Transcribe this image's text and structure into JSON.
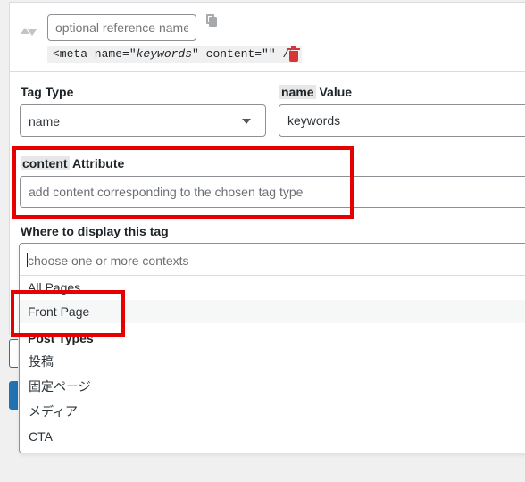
{
  "meta_entry": {
    "reference_placeholder": "optional reference name",
    "code": {
      "open": "<meta name=\"",
      "name_value": "keywords",
      "mid": "\" content=\"\" />"
    }
  },
  "tag_type": {
    "label": "Tag Type",
    "selected": "name"
  },
  "name_value": {
    "code_label": "name",
    "label": "Value",
    "value": "keywords"
  },
  "content_attribute": {
    "code_label": "content",
    "label": "Attribute",
    "placeholder": "add content corresponding to the chosen tag type"
  },
  "display": {
    "label": "Where to display this tag",
    "search_placeholder": "choose one or more contexts",
    "options": [
      "All Pages",
      "Front Page"
    ],
    "group_label": "Post Types",
    "group_options": [
      "投稿",
      "固定ページ",
      "メディア",
      "CTA"
    ]
  },
  "colors": {
    "highlight_box": "#e60000",
    "delete": "#d63638",
    "accent": "#2271b1"
  }
}
